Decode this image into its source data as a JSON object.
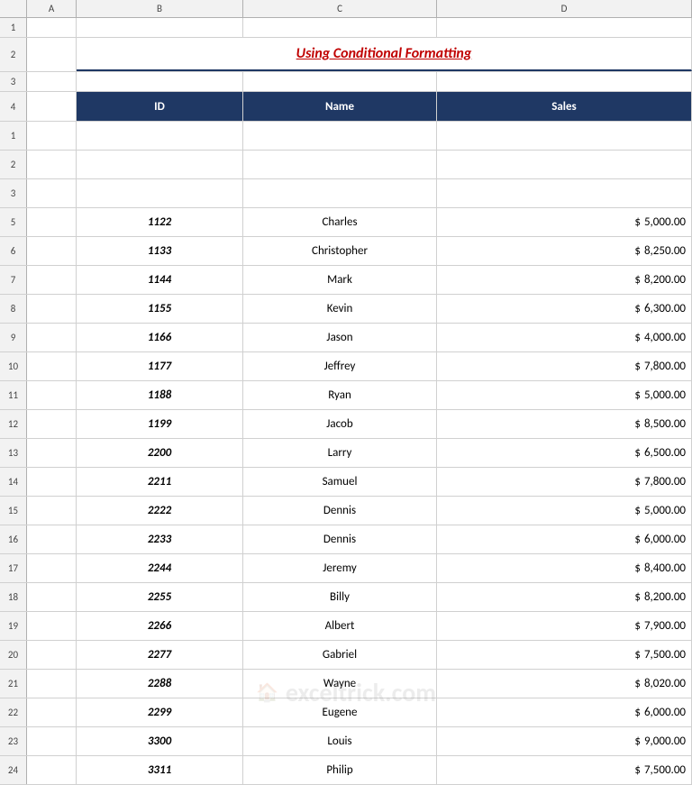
{
  "title": "Using Conditional Formatting",
  "columns": {
    "a_label": "A",
    "b_label": "B",
    "c_label": "C",
    "d_label": "D",
    "b_header": "ID",
    "c_header": "Name",
    "d_header": "Sales"
  },
  "rows": [
    {
      "row_num": "1",
      "id": "",
      "name": "",
      "dollar": "",
      "sales": ""
    },
    {
      "row_num": "2",
      "id": "",
      "name": "",
      "dollar": "",
      "sales": ""
    },
    {
      "row_num": "3",
      "id": "",
      "name": "",
      "dollar": "",
      "sales": ""
    },
    {
      "row_num": "5",
      "id": "1122",
      "name": "Charles",
      "dollar": "$",
      "sales": "5,000.00"
    },
    {
      "row_num": "6",
      "id": "1133",
      "name": "Christopher",
      "dollar": "$",
      "sales": "8,250.00"
    },
    {
      "row_num": "7",
      "id": "1144",
      "name": "Mark",
      "dollar": "$",
      "sales": "8,200.00"
    },
    {
      "row_num": "8",
      "id": "1155",
      "name": "Kevin",
      "dollar": "$",
      "sales": "6,300.00"
    },
    {
      "row_num": "9",
      "id": "1166",
      "name": "Jason",
      "dollar": "$",
      "sales": "4,000.00"
    },
    {
      "row_num": "10",
      "id": "1177",
      "name": "Jeffrey",
      "dollar": "$",
      "sales": "7,800.00"
    },
    {
      "row_num": "11",
      "id": "1188",
      "name": "Ryan",
      "dollar": "$",
      "sales": "5,000.00"
    },
    {
      "row_num": "12",
      "id": "1199",
      "name": "Jacob",
      "dollar": "$",
      "sales": "8,500.00"
    },
    {
      "row_num": "13",
      "id": "2200",
      "name": "Larry",
      "dollar": "$",
      "sales": "6,500.00"
    },
    {
      "row_num": "14",
      "id": "2211",
      "name": "Samuel",
      "dollar": "$",
      "sales": "7,800.00"
    },
    {
      "row_num": "15",
      "id": "2222",
      "name": "Dennis",
      "dollar": "$",
      "sales": "5,000.00"
    },
    {
      "row_num": "16",
      "id": "2233",
      "name": "Dennis",
      "dollar": "$",
      "sales": "6,000.00"
    },
    {
      "row_num": "17",
      "id": "2244",
      "name": "Jeremy",
      "dollar": "$",
      "sales": "8,400.00"
    },
    {
      "row_num": "18",
      "id": "2255",
      "name": "Billy",
      "dollar": "$",
      "sales": "8,200.00"
    },
    {
      "row_num": "19",
      "id": "2266",
      "name": "Albert",
      "dollar": "$",
      "sales": "7,900.00"
    },
    {
      "row_num": "20",
      "id": "2277",
      "name": "Gabriel",
      "dollar": "$",
      "sales": "7,500.00"
    },
    {
      "row_num": "21",
      "id": "2288",
      "name": "Wayne",
      "dollar": "$",
      "sales": "8,020.00"
    },
    {
      "row_num": "22",
      "id": "2299",
      "name": "Eugene",
      "dollar": "$",
      "sales": "6,000.00"
    },
    {
      "row_num": "23",
      "id": "3300",
      "name": "Louis",
      "dollar": "$",
      "sales": "9,000.00"
    },
    {
      "row_num": "24",
      "id": "3311",
      "name": "Philip",
      "dollar": "$",
      "sales": "7,500.00"
    }
  ],
  "watermark": {
    "text": "exceltrick.com"
  }
}
